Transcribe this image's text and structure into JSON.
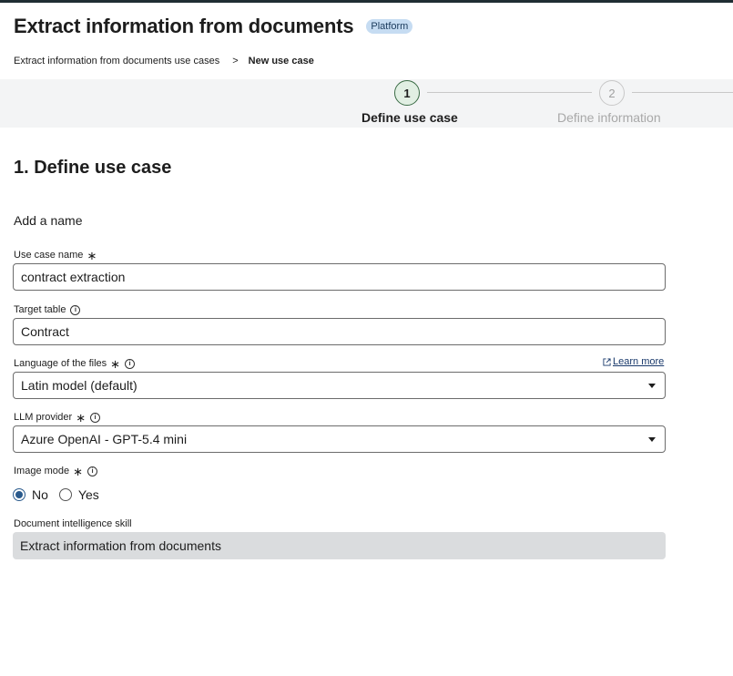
{
  "header": {
    "title": "Extract information from documents",
    "badge": "Platform"
  },
  "breadcrumb": {
    "items": [
      "Extract information from documents use cases",
      "New use case"
    ],
    "separator": ">"
  },
  "stepper": {
    "steps": [
      {
        "number": "1",
        "label": "Define use case",
        "state": "active"
      },
      {
        "number": "2",
        "label": "Define information",
        "state": "inactive"
      }
    ]
  },
  "form": {
    "section_title": "1. Define use case",
    "subheading": "Add a name",
    "required_mark": "∗",
    "info_icon": "i",
    "learn_more": "Learn more",
    "fields": {
      "use_case_name": {
        "label": "Use case name",
        "value": "contract extraction"
      },
      "target_table": {
        "label": "Target table",
        "value": "Contract"
      },
      "language": {
        "label": "Language of the files",
        "value": "Latin model (default)"
      },
      "llm_provider": {
        "label": "LLM provider",
        "value": "Azure OpenAI - GPT-5.4 mini"
      },
      "image_mode": {
        "label": "Image mode",
        "options": [
          "No",
          "Yes"
        ],
        "selected": "No"
      },
      "doc_skill": {
        "label": "Document intelligence skill",
        "value": "Extract information from documents"
      }
    }
  },
  "colors": {
    "accent": "#2a5a8c",
    "step_active_fill": "#e1efe3",
    "step_active_border": "#3a6b45",
    "badge_bg": "#c6dcf2",
    "stepper_bg": "#f3f4f5",
    "readonly_bg": "#dadcde"
  },
  "icons": [
    "info-icon",
    "external-link-icon",
    "chevron-right-icon",
    "dropdown-arrow-icon"
  ]
}
